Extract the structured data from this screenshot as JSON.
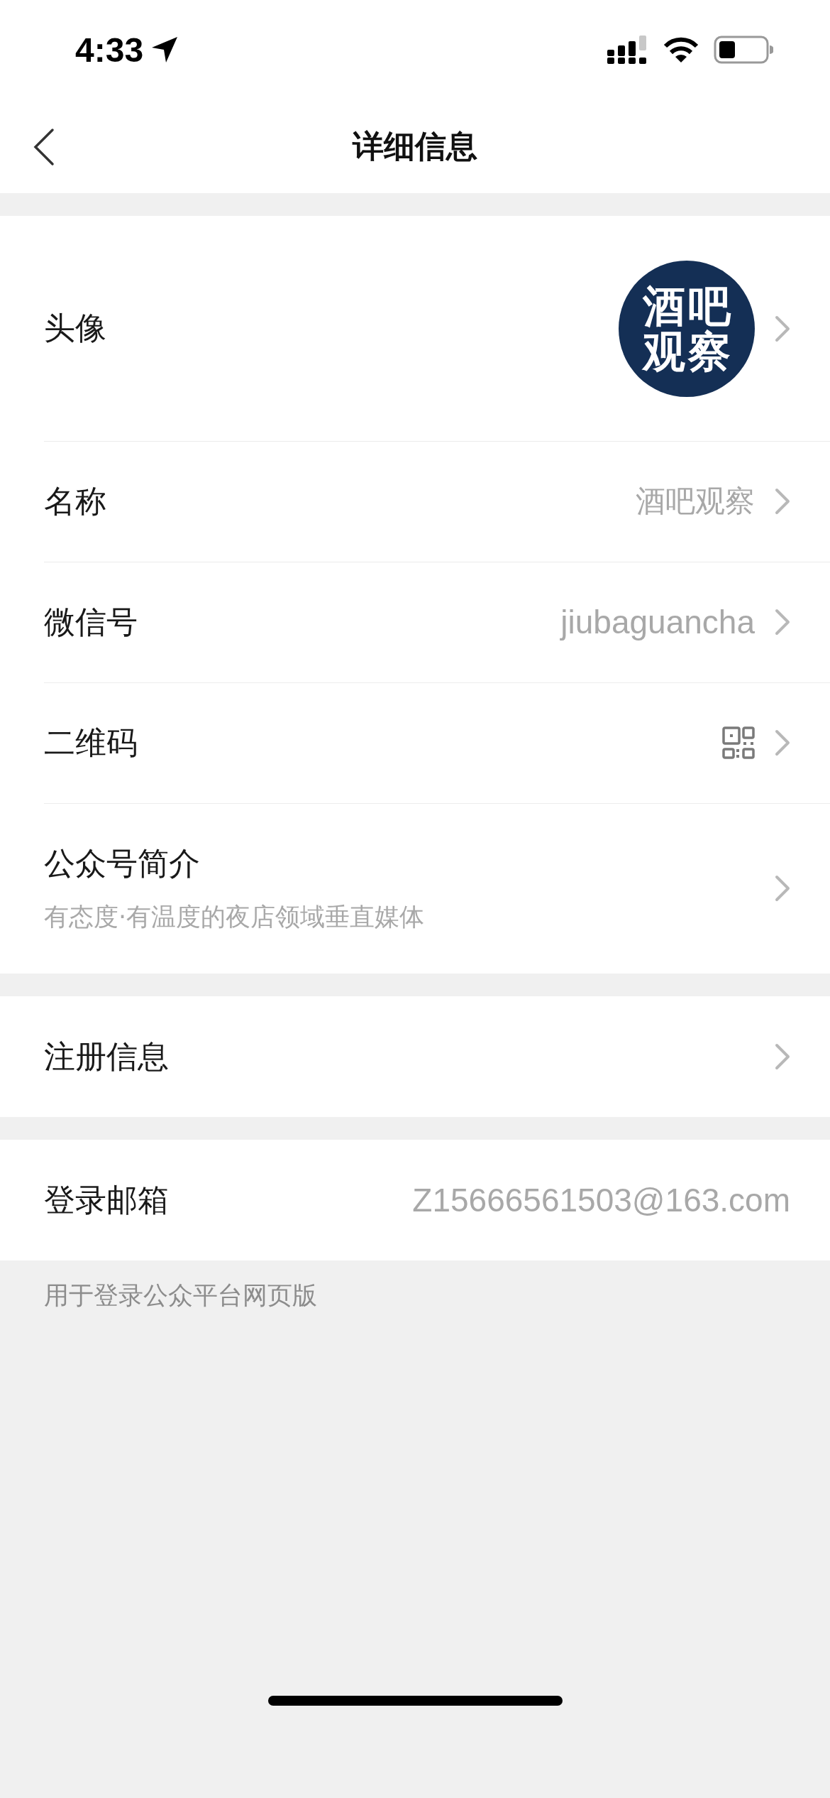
{
  "status_bar": {
    "time": "4:33"
  },
  "nav": {
    "title": "详细信息"
  },
  "sections": [
    {
      "rows": [
        {
          "kind": "avatar",
          "label": "头像",
          "avatar_text": "酒吧观察",
          "chevron": true
        },
        {
          "kind": "value",
          "label": "名称",
          "value": "酒吧观察",
          "chevron": true
        },
        {
          "kind": "value",
          "label": "微信号",
          "value": "jiubaguancha",
          "chevron": true
        },
        {
          "kind": "qr",
          "label": "二维码",
          "chevron": true
        },
        {
          "kind": "desc",
          "label": "公众号简介",
          "description": "有态度·有温度的夜店领域垂直媒体",
          "chevron": true
        }
      ]
    },
    {
      "rows": [
        {
          "kind": "value",
          "label": "注册信息",
          "chevron": true
        }
      ]
    },
    {
      "rows": [
        {
          "kind": "value",
          "label": "登录邮箱",
          "value": "Z15666561503@163.com",
          "chevron": false
        }
      ]
    }
  ],
  "footnote": "用于登录公众平台网页版"
}
